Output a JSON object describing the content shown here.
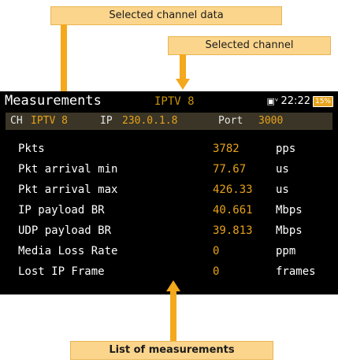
{
  "callouts": {
    "selected_channel_data": "Selected channel data",
    "selected_channel": "Selected channel",
    "list_of_measurements": "List of measurements"
  },
  "screen": {
    "title": "Measurements",
    "selected_channel": "IPTV 8",
    "time": "22:22",
    "battery": "15%",
    "info": {
      "ch_label": "CH",
      "ch_value": "IPTV 8",
      "ip_label": "IP",
      "ip_value": "230.0.1.8",
      "port_label": "Port",
      "port_value": "3000"
    },
    "measurements": [
      {
        "name": "Pkts",
        "value": "3782",
        "unit": "pps"
      },
      {
        "name": "Pkt arrival min",
        "value": "77.67",
        "unit": "us"
      },
      {
        "name": "Pkt arrival max",
        "value": "426.33",
        "unit": "us"
      },
      {
        "name": "IP payload BR",
        "value": "40.661",
        "unit": "Mbps"
      },
      {
        "name": "UDP payload BR",
        "value": "39.813",
        "unit": "Mbps"
      },
      {
        "name": "Media Loss Rate",
        "value": "0",
        "unit": "ppm"
      },
      {
        "name": "Lost IP Frame",
        "value": "0",
        "unit": "frames"
      }
    ]
  },
  "colors": {
    "accent": "#e7a21a",
    "callout_fill": "#fbd58c",
    "arrow": "#f4a81c",
    "info_bar": "#3a3526"
  }
}
